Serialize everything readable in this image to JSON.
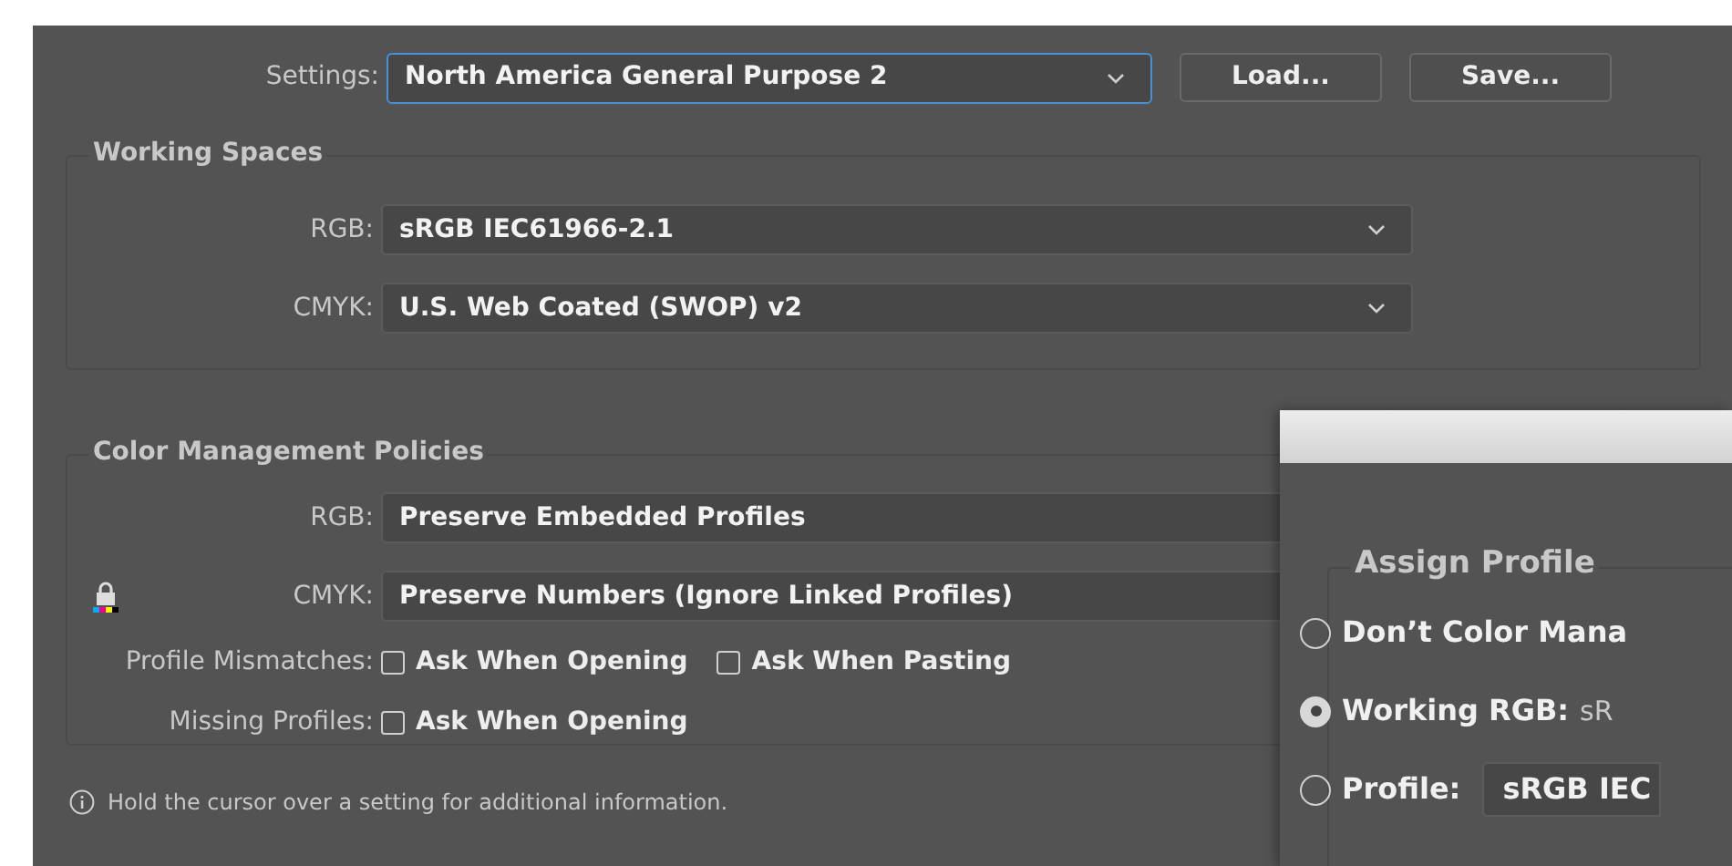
{
  "settings": {
    "label": "Settings:",
    "value": "North America General Purpose 2"
  },
  "buttons": [
    "Load...",
    "Save..."
  ],
  "working_spaces": {
    "title": "Working Spaces",
    "rows": [
      {
        "label": "RGB:",
        "value": "sRGB IEC61966-2.1"
      },
      {
        "label": "CMYK:",
        "value": "U.S. Web Coated (SWOP) v2"
      }
    ]
  },
  "policies": {
    "title": "Color Management Policies",
    "rows": [
      {
        "label": "RGB:",
        "value": "Preserve Embedded Profiles",
        "locked": false
      },
      {
        "label": "CMYK:",
        "value": "Preserve Numbers (Ignore Linked Profiles)",
        "locked": true
      }
    ],
    "checks": [
      {
        "label": "Profile Mismatches:",
        "options": [
          {
            "label": "Ask When Opening",
            "checked": false
          },
          {
            "label": "Ask When Pasting",
            "checked": false
          }
        ]
      },
      {
        "label": "Missing Profiles:",
        "options": [
          {
            "label": "Ask When Opening",
            "checked": false
          }
        ]
      }
    ]
  },
  "footer": "Hold the cursor over a setting for additional information.",
  "assign_dialog": {
    "title": "Assign Profile",
    "options": [
      {
        "kind": "plain",
        "label": "Don’t Color Mana",
        "selected": false
      },
      {
        "kind": "value",
        "label": "Working RGB:",
        "value": "sR",
        "selected": true
      },
      {
        "kind": "field",
        "label": "Profile:",
        "value": "sRGB IEC",
        "selected": false
      }
    ]
  }
}
